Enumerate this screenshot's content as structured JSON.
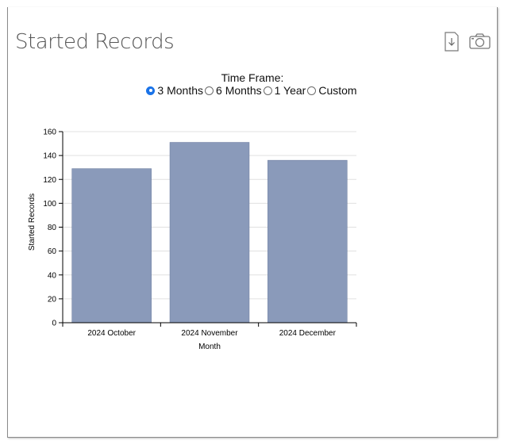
{
  "widget": {
    "title": "Started Records",
    "accent_color": "#2eb0e4",
    "icons": [
      "download-icon",
      "camera-icon"
    ]
  },
  "timeframe": {
    "label": "Time Frame:",
    "options": [
      "3 Months",
      "6 Months",
      "1 Year",
      "Custom"
    ],
    "selected": "3 Months"
  },
  "chart_data": {
    "type": "bar",
    "categories": [
      "2024 October",
      "2024 November",
      "2024 December"
    ],
    "values": [
      129,
      151,
      136
    ],
    "xlabel": "Month",
    "ylabel": "Started Records",
    "ylim": [
      0,
      160
    ],
    "yticks": [
      0,
      20,
      40,
      60,
      80,
      100,
      120,
      140,
      160
    ],
    "grid": true,
    "bar_color": "#8a9aba"
  }
}
